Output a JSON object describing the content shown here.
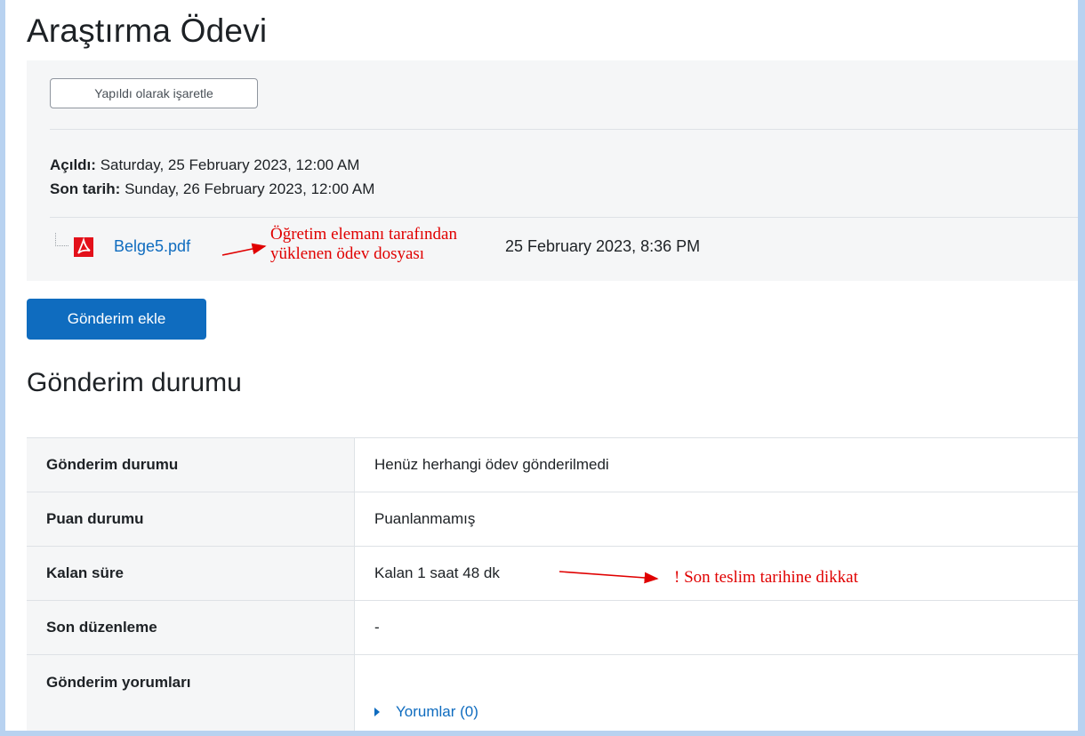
{
  "page": {
    "title": "Araştırma Ödevi"
  },
  "activity": {
    "mark_done_label": "Yapıldı olarak işaretle",
    "opened_label": "Açıldı:",
    "opened_value": "Saturday, 25 February 2023, 12:00 AM",
    "due_label": "Son tarih:",
    "due_value": "Sunday, 26 February 2023, 12:00 AM",
    "file": {
      "name": "Belge5.pdf",
      "icon": "pdf-icon",
      "date": "25 February 2023, 8:36 PM"
    }
  },
  "annotations": {
    "file_note_line1": "Öğretim elemanı tarafından",
    "file_note_line2": "yüklenen ödev dosyası",
    "deadline_note": "! Son teslim tarihine dikkat",
    "color": "#e00000"
  },
  "add_submission_label": "Gönderim ekle",
  "status_section": {
    "title": "Gönderim durumu",
    "rows": [
      {
        "label": "Gönderim durumu",
        "value": "Henüz herhangi ödev gönderilmedi"
      },
      {
        "label": "Puan durumu",
        "value": "Puanlanmamış"
      },
      {
        "label": "Kalan süre",
        "value": "Kalan 1 saat 48 dk"
      },
      {
        "label": "Son düzenleme",
        "value": "-"
      },
      {
        "label": "Gönderim yorumları",
        "value": "Yorumlar (0)"
      }
    ]
  },
  "colors": {
    "accent": "#0f6cbf",
    "frame": "#b8d2f0",
    "panel": "#f5f6f7"
  }
}
